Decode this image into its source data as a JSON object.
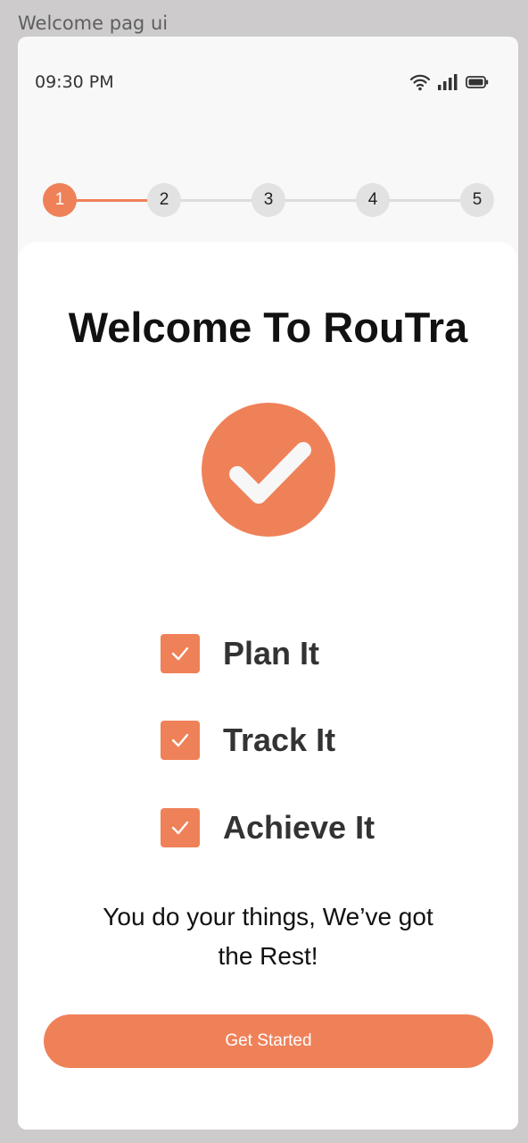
{
  "frame_label": "Welcome pag ui",
  "status_bar": {
    "time": "09:30 PM",
    "icons": [
      "wifi-icon",
      "signal-icon",
      "battery-icon"
    ]
  },
  "stepper": {
    "steps": [
      "1",
      "2",
      "3",
      "4",
      "5"
    ],
    "current": 1
  },
  "welcome": {
    "title": "Welcome To RouTra",
    "hero_icon": "check-circle-icon",
    "features": [
      "Plan It",
      "Track It",
      "Achieve It"
    ],
    "tagline_line1": "You do your things, We’ve got",
    "tagline_line2": "the Rest!",
    "cta_label": "Get Started"
  },
  "colors": {
    "accent": "#ef8159",
    "background": "#f8f8f8",
    "card": "#ffffff"
  }
}
